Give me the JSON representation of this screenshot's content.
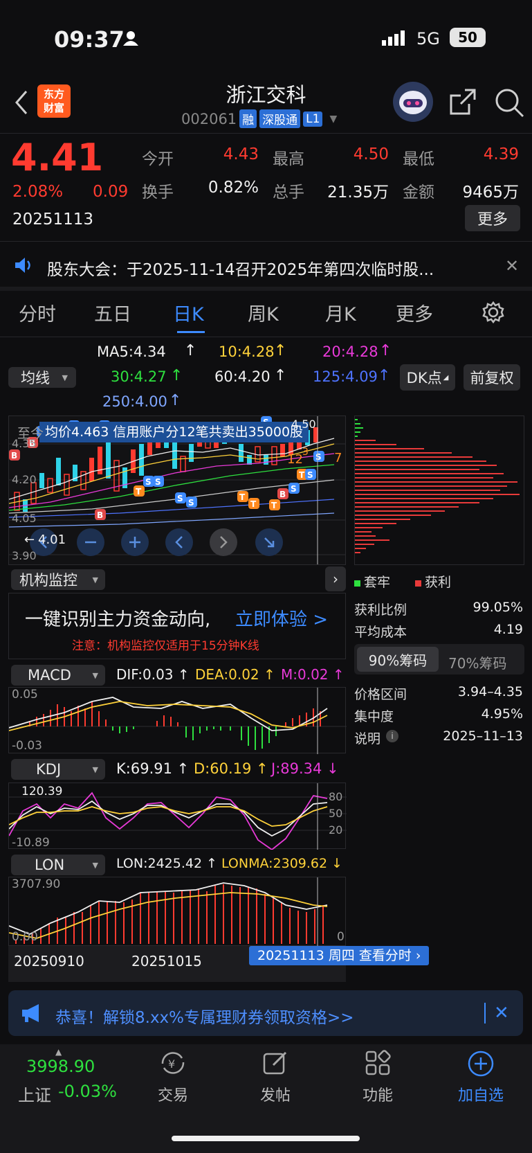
{
  "status_bar": {
    "time": "09:37",
    "network": "5G",
    "battery": "50"
  },
  "header": {
    "logo_line1": "东方",
    "logo_line2": "财富",
    "title": "浙江交科",
    "code": "002061",
    "tags": [
      "融",
      "深股通",
      "L1"
    ]
  },
  "quote": {
    "price": "4.41",
    "change_pct": "2.08%",
    "change": "0.09",
    "date": "20251113",
    "open_label": "今开",
    "open": "4.43",
    "high_label": "最高",
    "high": "4.50",
    "low_label": "最低",
    "low": "4.39",
    "turnover_label": "换手",
    "turnover": "0.82%",
    "volume_label": "总手",
    "volume": "21.35万",
    "amount_label": "金额",
    "amount": "9465万",
    "more": "更多"
  },
  "notice": {
    "text": "股东大会：于2025-11-14召开2025年第四次临时股..."
  },
  "tabs": [
    "分时",
    "五日",
    "日K",
    "周K",
    "月K",
    "更多"
  ],
  "ma": {
    "selector": "均线",
    "ma5": "MA5:4.34",
    "ma10": "10:4.28",
    "ma20": "20:4.28",
    "ma30": "30:4.27",
    "ma60": "60:4.20",
    "ma125": "125:4.09",
    "ma250": "250:4.00",
    "dk_button": "DK点",
    "adjust_button": "前复权"
  },
  "kchart": {
    "banner": "均价4.463 信用账户分12笔共卖出35000股",
    "banner_prefix": "至今",
    "top_price": "4.50",
    "y_labels": [
      "4.35",
      "4.20",
      "4.05",
      "3.90"
    ],
    "low_marker": "4.01",
    "tag_12": "12",
    "tag_7": "7",
    "tag_3": "3"
  },
  "institution": {
    "selector": "机构监控",
    "headline": "一键识别主力资金动向,",
    "cta": "立即体验 >",
    "note": "注意：机构监控仅适用于15分钟K线"
  },
  "chips": {
    "legend_trapped": "套牢",
    "legend_profit": "获利",
    "profit_ratio_label": "获利比例",
    "profit_ratio": "99.05%",
    "avg_cost_label": "平均成本",
    "avg_cost": "4.19",
    "tab90": "90%筹码",
    "tab70": "70%筹码",
    "range_label": "价格区间",
    "range": "3.94–4.35",
    "concentration_label": "集中度",
    "concentration": "4.95%",
    "note_label": "说明",
    "note_date": "2025–11–13"
  },
  "macd": {
    "selector": "MACD",
    "dif": "DIF:0.03",
    "dea": "DEA:0.02",
    "m": "M:0.02",
    "top": "0.05",
    "bottom": "-0.03"
  },
  "kdj": {
    "selector": "KDJ",
    "k": "K:69.91",
    "d": "D:60.19",
    "j": "J:89.34",
    "top": "120.39",
    "bottom": "-10.89",
    "r80": "80",
    "r50": "50",
    "r20": "20"
  },
  "lon": {
    "selector": "LON",
    "lon": "LON:2425.42",
    "lonma": "LONMA:2309.62",
    "top": "3707.90",
    "bottom": "0.00",
    "right0": "0"
  },
  "x_axis": {
    "d1": "20250910",
    "d2": "20251015",
    "cursor": "20251113 周四 查看分时"
  },
  "promo": {
    "text": "恭喜！解锁8.xx%专属理财券领取资格>>"
  },
  "bottom_nav": {
    "index_value": "3998.90",
    "index_name": "上证",
    "index_change": "-0.03%",
    "trade": "交易",
    "post": "发帖",
    "function": "功能",
    "add": "加自选"
  },
  "colors": {
    "up": "#ff3b30",
    "down": "#2ee03f",
    "accent": "#2c6fd6",
    "cyan_candle": "#2fd3e8"
  }
}
